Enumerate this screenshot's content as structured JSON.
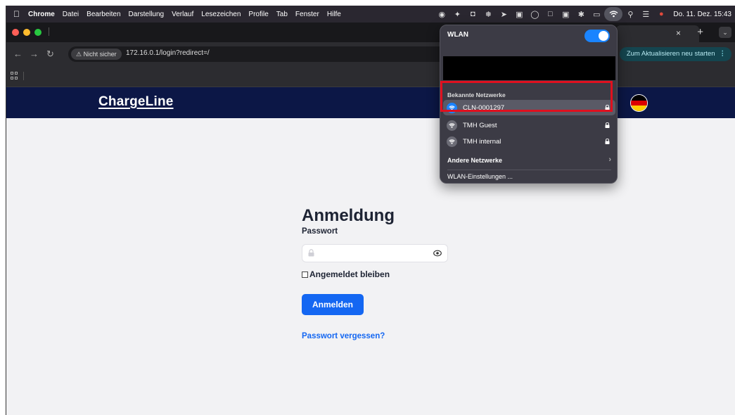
{
  "menubar": {
    "items": [
      "Chrome",
      "Datei",
      "Bearbeiten",
      "Darstellung",
      "Verlauf",
      "Lesezeichen",
      "Profile",
      "Tab",
      "Fenster",
      "Hilfe"
    ],
    "clock": "Do. 11. Dez. 15:43"
  },
  "browser": {
    "security_chip": "⚠ Nicht sicher",
    "url": "172.16.0.1/login?redirect=/",
    "restart_label": "Zum Aktualisieren neu starten",
    "kebab": "⋮",
    "tab_close": "×",
    "new_tab": "+",
    "tab_menu": "⌄"
  },
  "site": {
    "logo": "ChargeLine",
    "flag_colors": [
      "#000000",
      "#dd0000",
      "#ffce00"
    ]
  },
  "login": {
    "title": "Anmeldung",
    "password_label": "Passwort",
    "remember_label": "Angemeldet bleiben",
    "submit_label": "Anmelden",
    "forgot_label": "Passwort vergessen?"
  },
  "wifi_menu": {
    "header": "WLAN",
    "enabled": true,
    "known_title": "Bekannte Netzwerke",
    "known_networks": [
      {
        "name": "CLN-0001297",
        "connected": true,
        "locked": true
      },
      {
        "name": "TMH Guest",
        "connected": false,
        "locked": true
      },
      {
        "name": "TMH internal",
        "connected": false,
        "locked": true
      }
    ],
    "other_networks_label": "Andere Netzwerke",
    "other_chevron": "›",
    "settings_label": "WLAN-Einstellungen ..."
  },
  "colors": {
    "header_bg": "#0c1746",
    "primary": "#1467f2",
    "highlight_box": "#e0101f",
    "wifi_blue": "#1a84ff"
  }
}
